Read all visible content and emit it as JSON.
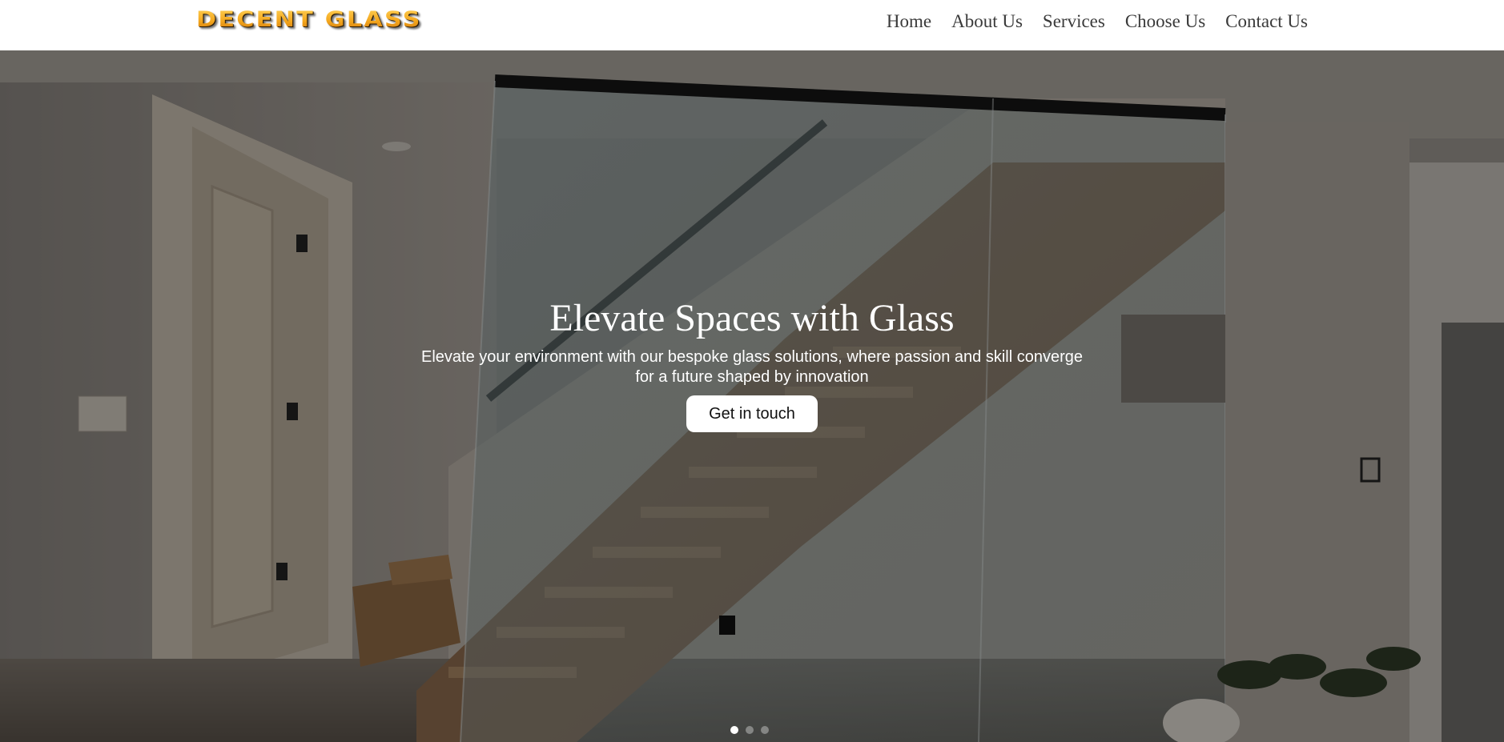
{
  "brand": {
    "logo_text": "DECENT GLASS"
  },
  "nav": {
    "items": [
      {
        "label": "Home"
      },
      {
        "label": "About Us"
      },
      {
        "label": "Services"
      },
      {
        "label": "Choose Us"
      },
      {
        "label": "Contact Us"
      }
    ]
  },
  "hero": {
    "title": "Elevate Spaces with Glass",
    "subtitle": "Elevate your environment with our bespoke glass solutions, where passion and skill converge for a future shaped by innovation",
    "cta_label": "Get in touch",
    "slider": {
      "slide_count": 3,
      "active_index": 0
    }
  },
  "colors": {
    "logo_gold": "#f3a51c",
    "nav_text": "#3a3a3a",
    "header_bg": "#ffffff",
    "cta_bg": "#ffffff"
  }
}
